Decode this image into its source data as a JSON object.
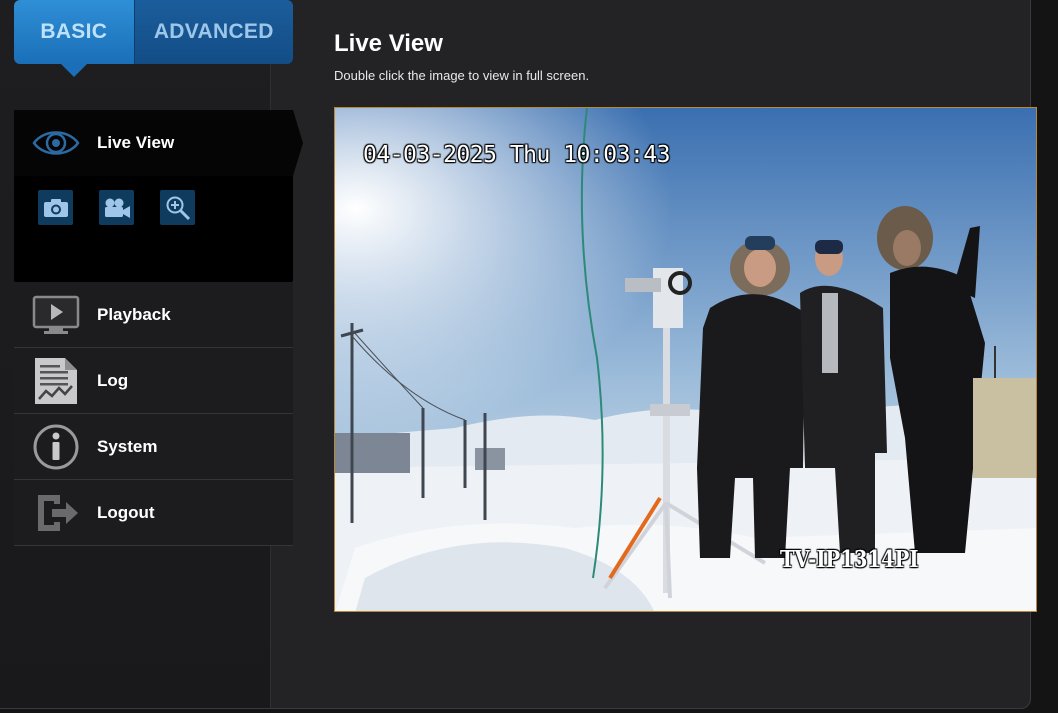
{
  "tabs": {
    "basic": "BASIC",
    "advanced": "ADVANCED"
  },
  "nav": {
    "live_view": "Live View",
    "live_view_tools": [
      "camera-icon",
      "video-camera-icon",
      "zoom-icon"
    ],
    "items": [
      {
        "label": "Playback",
        "icon": "playback-icon"
      },
      {
        "label": "Log",
        "icon": "log-icon"
      },
      {
        "label": "System",
        "icon": "info-icon"
      },
      {
        "label": "Logout",
        "icon": "logout-icon"
      }
    ]
  },
  "main": {
    "title": "Live View",
    "hint": "Double click the image to view in full screen.",
    "video": {
      "timestamp": "04-03-2025 Thu 10:03:43",
      "camera_name": "TV-IP1314PI"
    }
  },
  "colors": {
    "accent": "#2f8fd6",
    "accent_dark": "#134d86",
    "tool_bg": "#0f3c5e",
    "video_border": "#b88a38"
  }
}
